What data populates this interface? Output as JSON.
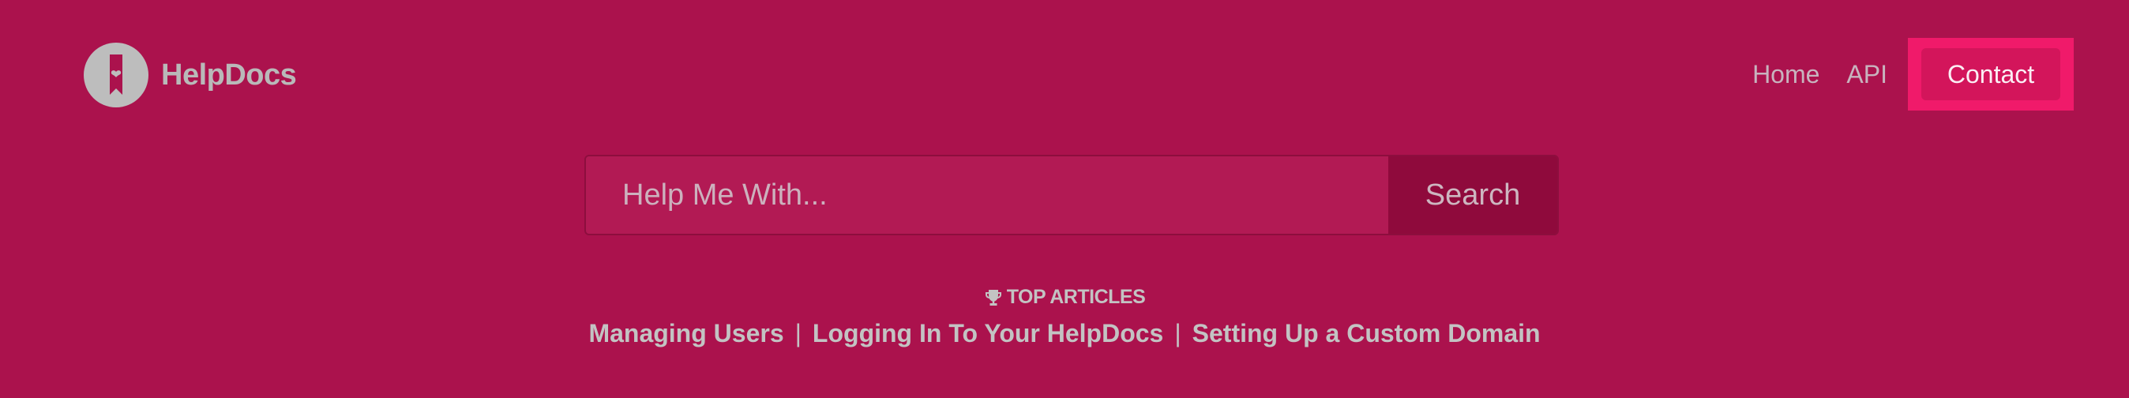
{
  "brand": {
    "name": "HelpDocs",
    "logo_icon": "helpdocs-bookmark-heart-logo"
  },
  "nav": {
    "home": "Home",
    "api": "API",
    "contact": "Contact"
  },
  "search": {
    "placeholder": "Help Me With...",
    "button": "Search"
  },
  "top_articles": {
    "heading": "TOP ARTICLES",
    "icon": "trophy-icon",
    "separator": "|",
    "items": [
      "Managing Users",
      "Logging In To Your HelpDocs",
      "Setting Up a Custom Domain"
    ]
  },
  "colors": {
    "background": "#ab124d",
    "accent": "#f01a6a",
    "contact_button": "#d3155b",
    "search_button": "#8f0a3c"
  }
}
